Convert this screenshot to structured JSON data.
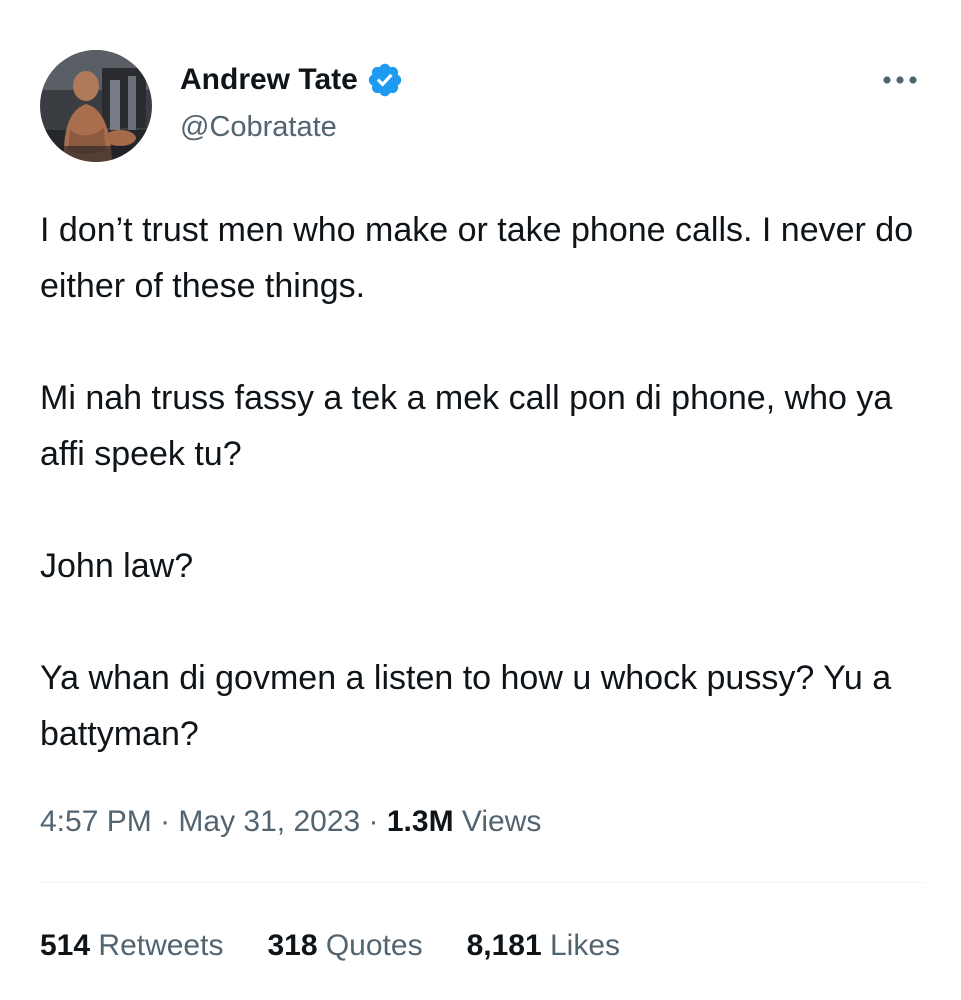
{
  "author": {
    "name": "Andrew Tate",
    "handle": "@Cobratate",
    "verified": true,
    "verified_color": "#1d9bf0"
  },
  "icons": {
    "avatar": "profile-photo",
    "verified": "verified-badge-icon",
    "more": "more-horizontal-icon"
  },
  "tweet": {
    "paragraphs": [
      "I don’t trust men who make or take phone calls. I never do either of these things.",
      "Mi nah truss fassy a tek a mek call pon di phone, who ya affi speek tu?",
      "John law?",
      "Ya whan di govmen a listen to how u whock pussy? Yu a battyman?"
    ]
  },
  "meta": {
    "time": "4:57 PM",
    "separator": " · ",
    "date": "May 31, 2023",
    "views_count": "1.3M",
    "views_label": " Views"
  },
  "stats": {
    "retweets_count": "514",
    "retweets_label": " Retweets",
    "quotes_count": "318",
    "quotes_label": " Quotes",
    "likes_count": "8,181",
    "likes_label": " Likes"
  },
  "colors": {
    "text": "#0f1419",
    "secondary": "#536471",
    "divider": "#eff3f4"
  }
}
